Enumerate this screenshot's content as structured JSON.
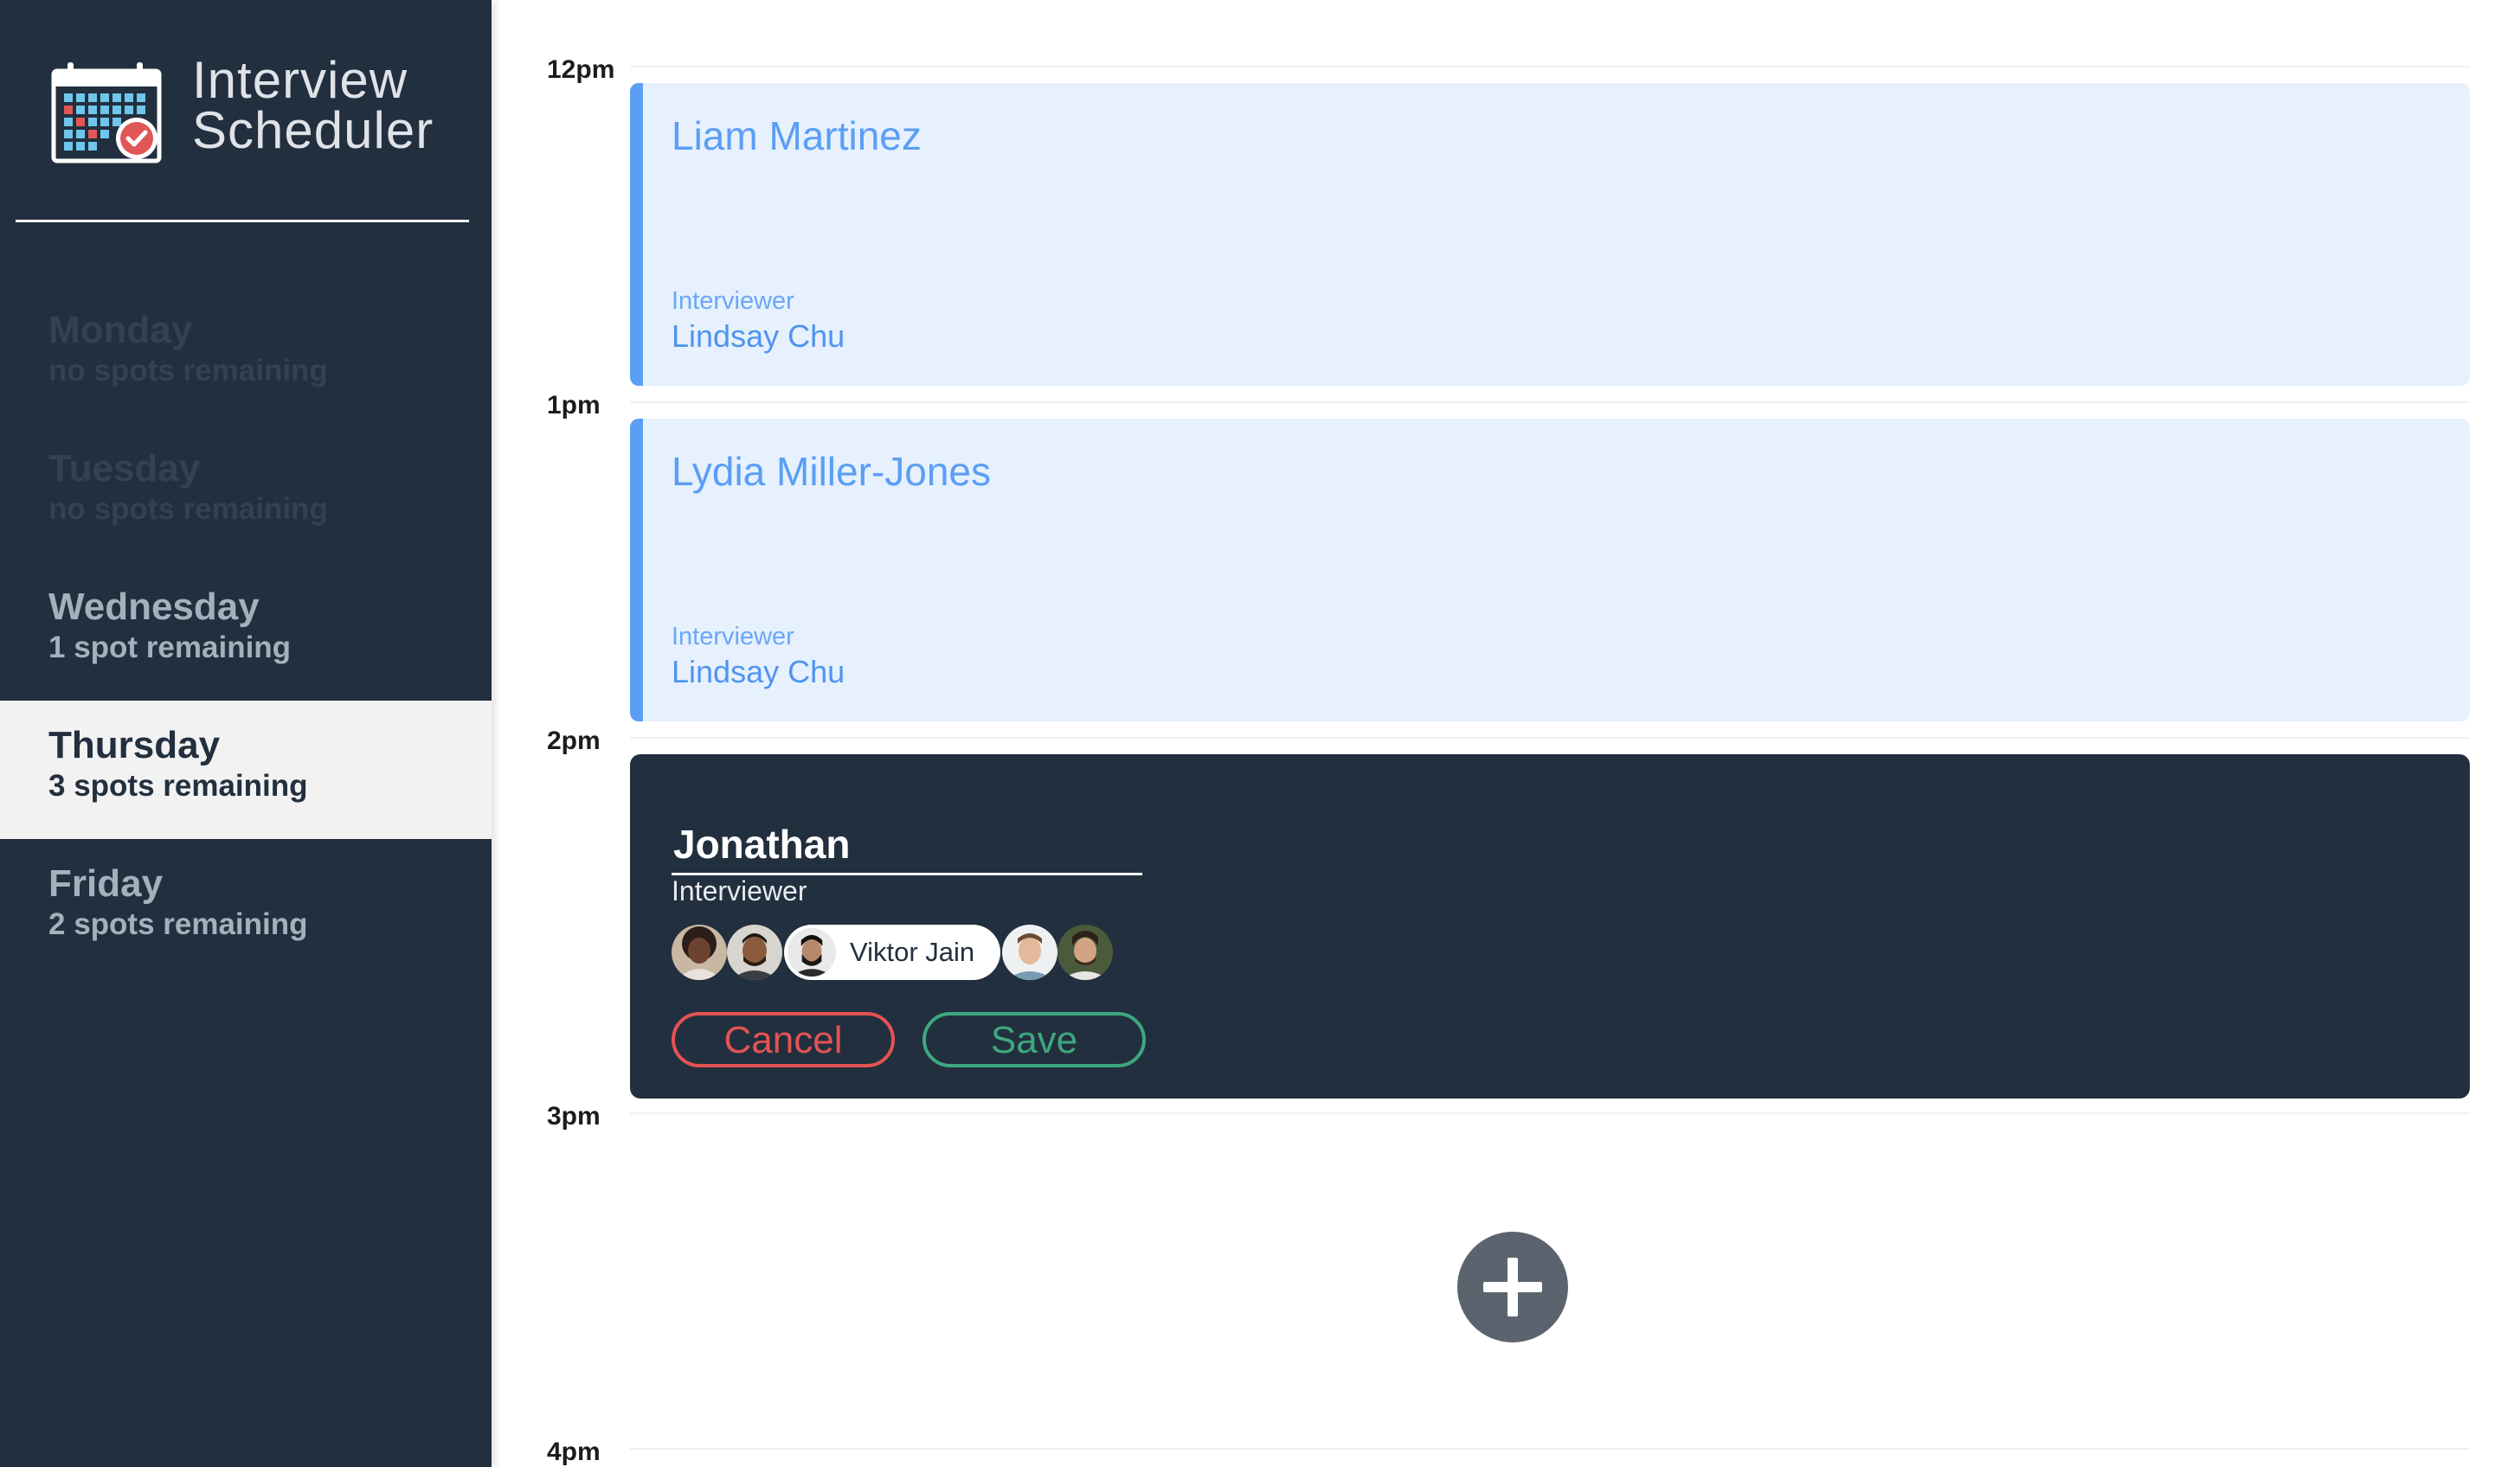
{
  "app": {
    "title_line1": "Interview",
    "title_line2": "Scheduler",
    "logo_icon": "calendar-check-icon"
  },
  "sidebar": {
    "days": [
      {
        "name": "Monday",
        "spots": "no spots remaining",
        "state": "full"
      },
      {
        "name": "Tuesday",
        "spots": "no spots remaining",
        "state": "full"
      },
      {
        "name": "Wednesday",
        "spots": "1 spot remaining",
        "state": "open"
      },
      {
        "name": "Thursday",
        "spots": "3 spots remaining",
        "state": "selected"
      },
      {
        "name": "Friday",
        "spots": "2 spots remaining",
        "state": "open"
      }
    ]
  },
  "schedule": {
    "times": [
      "12pm",
      "1pm",
      "2pm",
      "3pm",
      "4pm"
    ],
    "appointments": [
      {
        "student": "Liam Martinez",
        "interviewer_label": "Interviewer",
        "interviewer": "Lindsay Chu"
      },
      {
        "student": "Lydia Miller-Jones",
        "interviewer_label": "Interviewer",
        "interviewer": "Lindsay Chu"
      }
    ],
    "edit_form": {
      "student_value": "Jonathan",
      "interviewer_label": "Interviewer",
      "selected_interviewer": "Viktor Jain",
      "cancel_label": "Cancel",
      "save_label": "Save"
    },
    "add_icon": "plus-icon"
  },
  "colors": {
    "sidebar_bg": "#222f3e",
    "appointment_bg": "#e6f1fd",
    "appointment_accent": "#5b9ef5",
    "cancel": "#e35353",
    "save": "#3ea77f",
    "add_button": "#5b646e"
  }
}
